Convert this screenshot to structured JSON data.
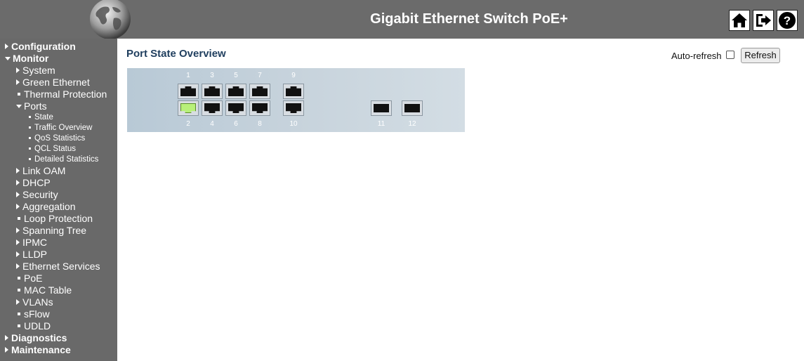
{
  "header": {
    "title": "Gigabit Ethernet Switch PoE+",
    "icons": [
      "home-icon",
      "logout-icon",
      "help-icon"
    ]
  },
  "sidebar": {
    "items": [
      {
        "label": "Configuration",
        "level": 0,
        "marker": "collapsed"
      },
      {
        "label": "Monitor",
        "level": 0,
        "marker": "expanded"
      },
      {
        "label": "System",
        "level": 1,
        "marker": "collapsed"
      },
      {
        "label": "Green Ethernet",
        "level": 1,
        "marker": "collapsed"
      },
      {
        "label": "Thermal Protection",
        "level": 1,
        "marker": "leaf"
      },
      {
        "label": "Ports",
        "level": 1,
        "marker": "expanded"
      },
      {
        "label": "State",
        "level": 2,
        "marker": "leaf"
      },
      {
        "label": "Traffic Overview",
        "level": 2,
        "marker": "leaf"
      },
      {
        "label": "QoS Statistics",
        "level": 2,
        "marker": "leaf"
      },
      {
        "label": "QCL Status",
        "level": 2,
        "marker": "leaf"
      },
      {
        "label": "Detailed Statistics",
        "level": 2,
        "marker": "leaf"
      },
      {
        "label": "Link OAM",
        "level": 1,
        "marker": "collapsed"
      },
      {
        "label": "DHCP",
        "level": 1,
        "marker": "collapsed"
      },
      {
        "label": "Security",
        "level": 1,
        "marker": "collapsed"
      },
      {
        "label": "Aggregation",
        "level": 1,
        "marker": "collapsed"
      },
      {
        "label": "Loop Protection",
        "level": 1,
        "marker": "leaf"
      },
      {
        "label": "Spanning Tree",
        "level": 1,
        "marker": "collapsed"
      },
      {
        "label": "IPMC",
        "level": 1,
        "marker": "collapsed"
      },
      {
        "label": "LLDP",
        "level": 1,
        "marker": "collapsed"
      },
      {
        "label": "Ethernet Services",
        "level": 1,
        "marker": "collapsed"
      },
      {
        "label": "PoE",
        "level": 1,
        "marker": "leaf"
      },
      {
        "label": "MAC Table",
        "level": 1,
        "marker": "leaf"
      },
      {
        "label": "VLANs",
        "level": 1,
        "marker": "collapsed"
      },
      {
        "label": "sFlow",
        "level": 1,
        "marker": "leaf"
      },
      {
        "label": "UDLD",
        "level": 1,
        "marker": "leaf"
      },
      {
        "label": "Diagnostics",
        "level": 0,
        "marker": "collapsed"
      },
      {
        "label": "Maintenance",
        "level": 0,
        "marker": "collapsed"
      }
    ]
  },
  "main": {
    "title": "Port State Overview",
    "autorefresh_label": "Auto-refresh",
    "autorefresh_checked": false,
    "refresh_label": "Refresh"
  },
  "ports": [
    {
      "number": "1",
      "type": "rj45",
      "link": false
    },
    {
      "number": "2",
      "type": "rj45",
      "link": true
    },
    {
      "number": "3",
      "type": "rj45",
      "link": false
    },
    {
      "number": "4",
      "type": "rj45",
      "link": false
    },
    {
      "number": "5",
      "type": "rj45",
      "link": false
    },
    {
      "number": "6",
      "type": "rj45",
      "link": false
    },
    {
      "number": "7",
      "type": "rj45",
      "link": false
    },
    {
      "number": "8",
      "type": "rj45",
      "link": false
    },
    {
      "number": "9",
      "type": "rj45",
      "link": false
    },
    {
      "number": "10",
      "type": "rj45",
      "link": false
    },
    {
      "number": "11",
      "type": "sfp",
      "link": false
    },
    {
      "number": "12",
      "type": "sfp",
      "link": false
    }
  ],
  "colors": {
    "header_bg": "#6b6b6b",
    "sidebar_bg": "#696969",
    "title_color": "#1f3e5e",
    "link_up": "#b8f07a"
  }
}
